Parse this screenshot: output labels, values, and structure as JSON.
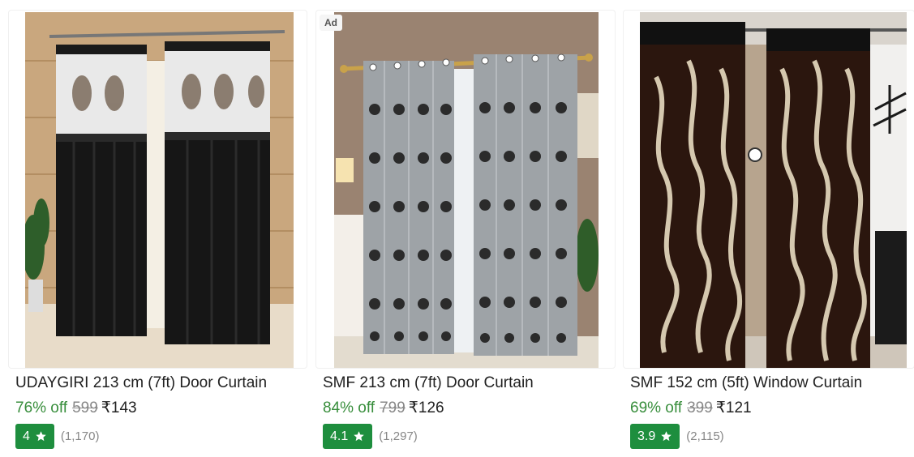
{
  "products": [
    {
      "title": "UDAYGIRI 213 cm (7ft) Door Curtain",
      "discount": "76% off",
      "mrp": "599",
      "price": "₹143",
      "rating": "4",
      "rating_count": "(1,170)",
      "ad": ""
    },
    {
      "title": "SMF 213 cm (7ft) Door Curtain",
      "discount": "84% off",
      "mrp": "799",
      "price": "₹126",
      "rating": "4.1",
      "rating_count": "(1,297)",
      "ad": "Ad"
    },
    {
      "title": "SMF 152 cm (5ft) Window Curtain",
      "discount": "69% off",
      "mrp": "399",
      "price": "₹121",
      "rating": "3.9",
      "rating_count": "(2,115)",
      "ad": ""
    }
  ],
  "colors": {
    "discount_green": "#388e3c",
    "rating_badge_green": "#1e8e3e",
    "muted_gray": "#878787",
    "text_dark": "#212121"
  },
  "icons": {
    "rating": "star-icon"
  }
}
